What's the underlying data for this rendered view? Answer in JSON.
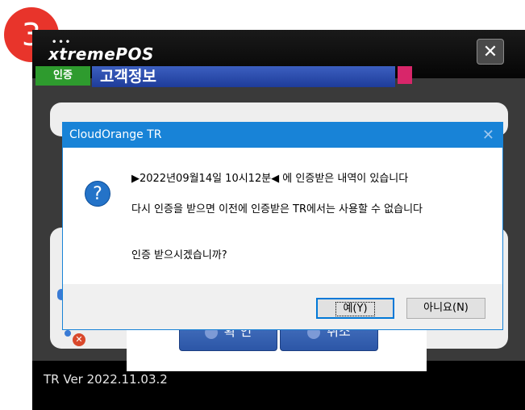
{
  "step": {
    "number": "3"
  },
  "app": {
    "logo": "xtremePOS",
    "close_glyph": "✕",
    "version": "TR Ver 2022.11.03.2"
  },
  "customer": {
    "auth_tag": "인증",
    "title": "고객정보"
  },
  "main_buttons": {
    "confirm": "확 인",
    "cancel": "취소"
  },
  "dialog": {
    "title": "CloudOrange TR",
    "close_glyph": "✕",
    "icon": "question-icon",
    "message_line1": "▶2022년09월14일 10시12분◀ 에 인증받은 내역이 있습니다",
    "message_line2": "다시 인증을 받으면 이전에 인증받은 TR에서는 사용할 수 없습니다",
    "message_line3": "인증 받으시겠습니까?",
    "yes_label": "예(Y)",
    "no_label": "아니요(N)"
  },
  "colors": {
    "dialog_accent": "#1883d7",
    "badge": "#e8342b",
    "auth_tag": "#2e9b2e",
    "customer_bar": "#2a4aab"
  }
}
